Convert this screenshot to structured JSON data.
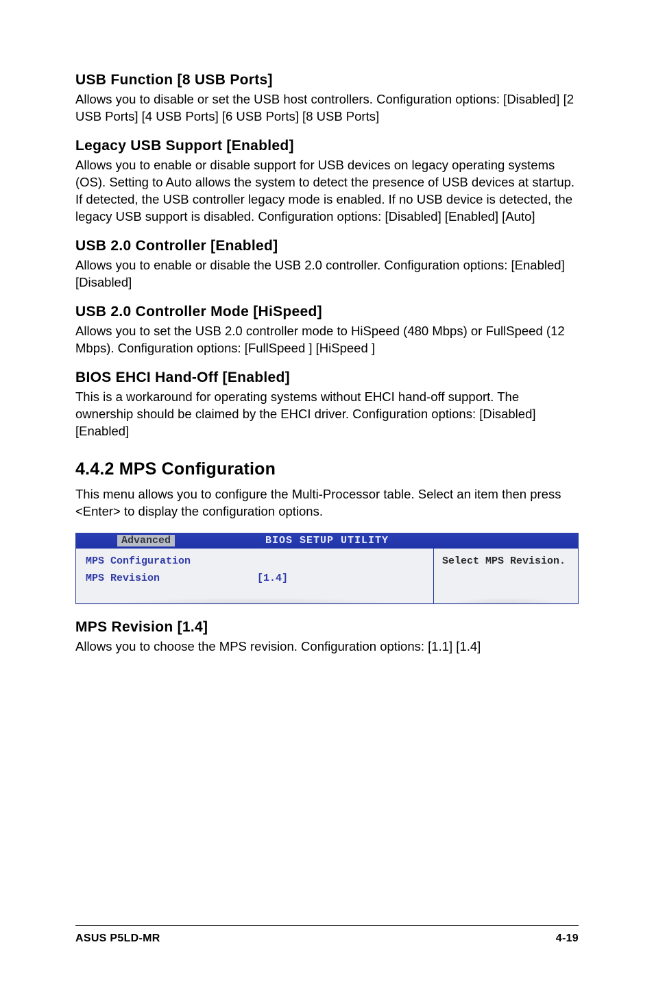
{
  "sections": {
    "usb_function": {
      "heading": "USB Function [8 USB Ports]",
      "body": "Allows you to disable or set the USB host controllers. Configuration options: [Disabled] [2 USB Ports] [4 USB Ports] [6 USB Ports] [8 USB Ports]"
    },
    "legacy_usb": {
      "heading": "Legacy USB Support [Enabled]",
      "body": "Allows you to enable or disable support for USB devices on legacy operating systems (OS). Setting to Auto allows the system to detect the presence of USB devices at startup. If detected, the USB controller legacy mode is enabled. If no USB device is detected, the legacy USB support is disabled. Configuration options: [Disabled] [Enabled] [Auto]"
    },
    "usb20_controller": {
      "heading": "USB 2.0 Controller [Enabled]",
      "body": "Allows you to enable or disable the USB 2.0 controller. Configuration options: [Enabled] [Disabled]"
    },
    "usb20_mode": {
      "heading": "USB 2.0 Controller Mode [HiSpeed]",
      "body": "Allows you to set the USB 2.0 controller mode to HiSpeed (480 Mbps) or FullSpeed (12 Mbps). Configuration options: [FullSpeed ] [HiSpeed ]"
    },
    "ehci": {
      "heading": "BIOS EHCI Hand-Off [Enabled]",
      "body": "This is a workaround for operating systems without EHCI hand-off support. The ownership should be claimed by the EHCI driver. Configuration options:  [Disabled] [Enabled]"
    },
    "mps_config": {
      "heading": "4.4.2   MPS Configuration",
      "body": "This menu allows you to configure the Multi-Processor table. Select an item then press <Enter> to display the configuration options."
    },
    "mps_revision": {
      "heading": "MPS Revision [1.4]",
      "body": "Allows you to choose the MPS revision. Configuration options: [1.1] [1.4]"
    }
  },
  "bios": {
    "title": "BIOS SETUP UTILITY",
    "tab": "Advanced",
    "config_title": "MPS Configuration",
    "row_label": "MPS Revision",
    "row_value": "[1.4]",
    "help_text": "Select MPS Revision."
  },
  "footer": {
    "left": "ASUS P5LD-MR",
    "right": "4-19"
  }
}
